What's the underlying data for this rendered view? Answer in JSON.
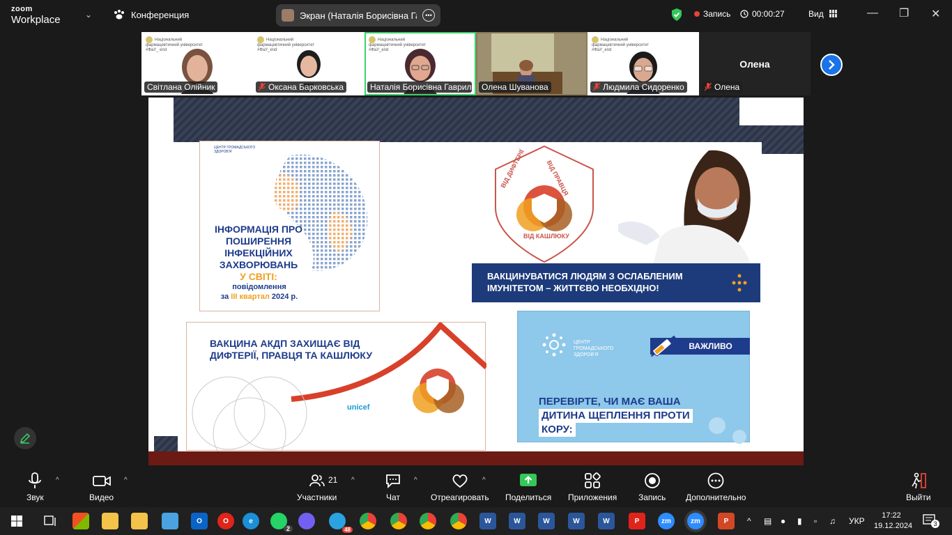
{
  "app": {
    "logo_line1": "zoom",
    "logo_line2": "Workplace",
    "meeting_name": "Конференция",
    "share_pill": "Экран (Наталія Борисівна Гаврилюк)",
    "recording_label": "Запись",
    "timer": "00:00:27",
    "view_label": "Вид"
  },
  "participants": [
    {
      "name": "Світлана Олійник",
      "muted": false,
      "header": "Національний фармацевтичний університет #ФаУ_ еnd"
    },
    {
      "name": "Оксана Барковська",
      "muted": true,
      "header": "Національний фармацевтичний університет #ФаУ_еnd"
    },
    {
      "name": "Наталія Борисівна Гаврилюк",
      "muted": true,
      "header": "Національний фармацевтичний університет #ФаУ_еnd"
    },
    {
      "name": "Олена Шуванова",
      "muted": false,
      "header": ""
    },
    {
      "name": "Людмила Сидоренко",
      "muted": true,
      "header": "Національний фармацевтичний університет #ФаУ_еnd"
    },
    {
      "name": "Олена",
      "muted": true,
      "header": ""
    }
  ],
  "slide": {
    "card1": {
      "logo": "ЦЕНТР ГРОМАДСЬКОГО ЗДОРОВ'Я",
      "title": "ІНФОРМАЦІЯ ПРО ПОШИРЕННЯ ІНФЕКЦІЙНИХ ЗАХВОРЮВАНЬ",
      "accent": "У СВІТІ:",
      "sub1": "повідомлення",
      "sub2_prefix": "за ",
      "sub2_accent": "III квартал",
      "sub2_suffix": " 2024 р."
    },
    "card2": {
      "shield_top_left": "ВІД ДИФТЕРІЇ",
      "shield_top_right": "ВІД ПРАВЦЯ",
      "shield_bottom": "ВІД КАШЛЮКУ",
      "banner_line1": "ВАКЦИНУВАТИСЯ ЛЮДЯМ З ОСЛАБЛЕНИМ",
      "banner_line2": "ІМУНІТЕТОМ – ЖИТТЄВО НЕОБХІДНО!"
    },
    "card3": {
      "title_line1": "ВАКЦИНА АКДП ЗАХИЩАЄ ВІД",
      "title_line2": "ДИФТЕРІЇ, ПРАВЦЯ ТА КАШЛЮКУ",
      "unicef": "unicef"
    },
    "card4": {
      "brand": "ЦЕНТР ГРОМАДСЬКОГО ЗДОРОВ'Я",
      "important": "ВАЖЛИВО",
      "q1": "ПЕРЕВІРТЕ, ЧИ МАЄ ВАША",
      "q2": "ДИТИНА ЩЕПЛЕННЯ ПРОТИ",
      "q3": "КОРУ:"
    }
  },
  "toolbar": {
    "audio": "Звук",
    "video": "Видео",
    "participants": "Участники",
    "participants_count": "21",
    "chat": "Чат",
    "react": "Отреагировать",
    "share": "Поделиться",
    "apps": "Приложения",
    "record": "Запись",
    "more": "Дополнительно",
    "leave": "Выйти"
  },
  "taskbar": {
    "whatsapp_badge": "2",
    "telegram_badge": "48",
    "lang": "УКР",
    "time": "17:22",
    "date": "19.12.2024",
    "notif": "3"
  },
  "colors": {
    "zoom_blue": "#1a73e8",
    "active_speaker": "#39d36b",
    "share_green": "#34c759",
    "record_red": "#e8423a",
    "slide_navy": "#1e3c8c"
  }
}
